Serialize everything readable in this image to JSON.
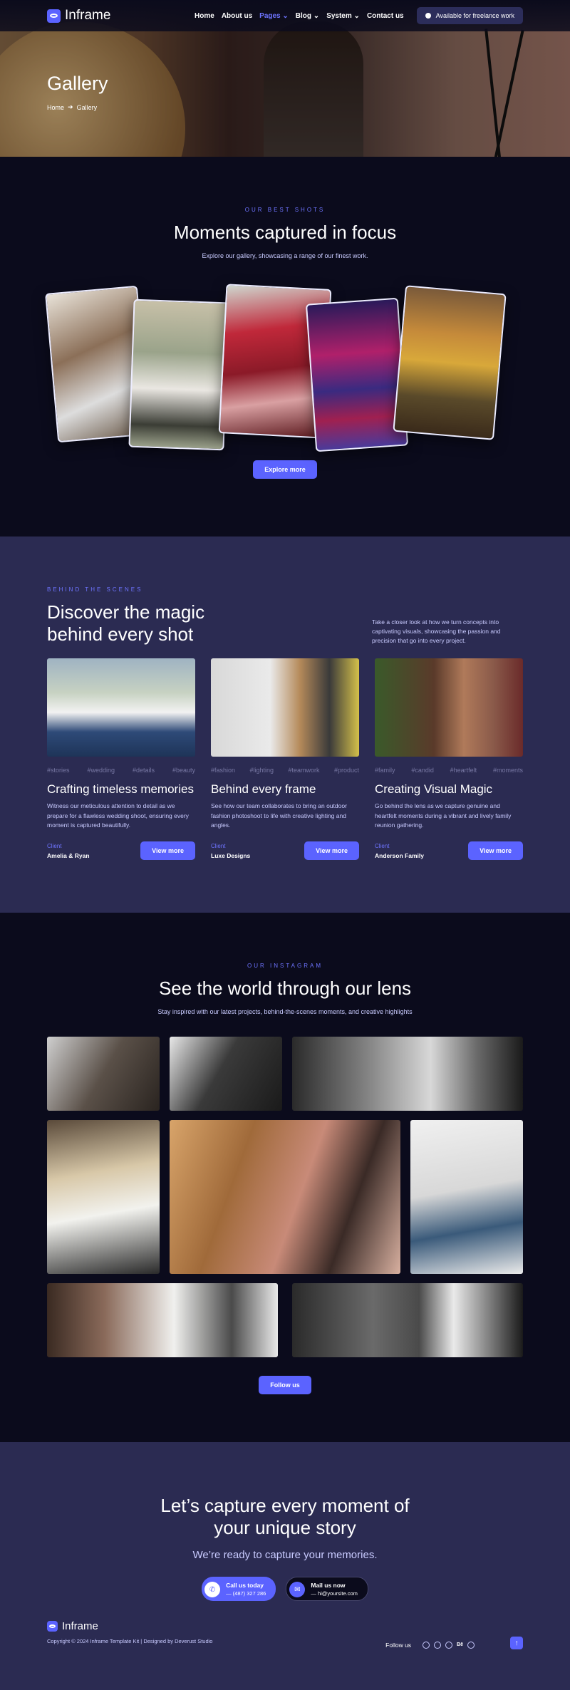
{
  "brand": {
    "name": "Inframe",
    "accent": "#5b63ff",
    "bg_dark": "#0b0b1c",
    "bg_panel": "#2b2b52"
  },
  "nav": {
    "items": [
      {
        "label": "Home"
      },
      {
        "label": "About us"
      },
      {
        "label": "Pages",
        "dropdown": true,
        "active": true
      },
      {
        "label": "Blog",
        "dropdown": true
      },
      {
        "label": "System",
        "dropdown": true
      },
      {
        "label": "Contact us"
      }
    ],
    "availability": "Available for freelance work"
  },
  "hero": {
    "title": "Gallery",
    "breadcrumb": [
      "Home",
      "Gallery"
    ]
  },
  "best_shots": {
    "eyebrow": "OUR BEST SHOTS",
    "title": "Moments captured in focus",
    "subtitle": "Explore our gallery, showcasing a range of our finest work.",
    "button": "Explore more"
  },
  "behind": {
    "eyebrow": "BEHIND THE SCENES",
    "title_line1": "Discover the magic",
    "title_line2": "behind every shot",
    "description": "Take a closer look at how we turn concepts into captivating visuals, showcasing the passion and precision that go into every project.",
    "cards": [
      {
        "tags": [
          "#stories",
          "#wedding",
          "#details",
          "#beauty"
        ],
        "title": "Crafting timeless memories",
        "text": "Witness our meticulous attention to detail as we prepare for a flawless wedding shoot, ensuring every moment is captured beautifully.",
        "client_label": "Client",
        "client": "Amelia & Ryan",
        "button": "View more"
      },
      {
        "tags": [
          "#fashion",
          "#lighting",
          "#teamwork",
          "#product"
        ],
        "title": "Behind every frame",
        "text": "See how our team collaborates to bring an outdoor fashion photoshoot to life with creative lighting and angles.",
        "client_label": "Client",
        "client": "Luxe Designs",
        "button": "View more"
      },
      {
        "tags": [
          "#family",
          "#candid",
          "#heartfelt",
          "#moments"
        ],
        "title": "Creating Visual Magic",
        "text": "Go behind the lens as we capture genuine and heartfelt moments during a vibrant and lively family reunion gathering.",
        "client_label": "Client",
        "client": "Anderson Family",
        "button": "View more"
      }
    ]
  },
  "instagram": {
    "eyebrow": "OUR INSTAGRAM",
    "title": "See the world through our lens",
    "subtitle": "Stay inspired with our latest projects, behind-the-scenes moments, and creative highlights",
    "button": "Follow us"
  },
  "cta": {
    "title_line1": "Let’s capture every moment of",
    "title_line2": "your unique story",
    "lead": "We’re ready to capture your memories.",
    "call_label": "Call us today",
    "call_value": "— (487) 327 286",
    "mail_label": "Mail us now",
    "mail_value": "— hi@yoursite.com"
  },
  "footer": {
    "brand": "Inframe",
    "copyright": "Copyright © 2024 Inframe Template Kit | Designed by Deverust Studio",
    "follow": "Follow us",
    "social": [
      "instagram-icon",
      "facebook-icon",
      "youtube-icon",
      "behance-icon",
      "dribbble-icon"
    ]
  }
}
